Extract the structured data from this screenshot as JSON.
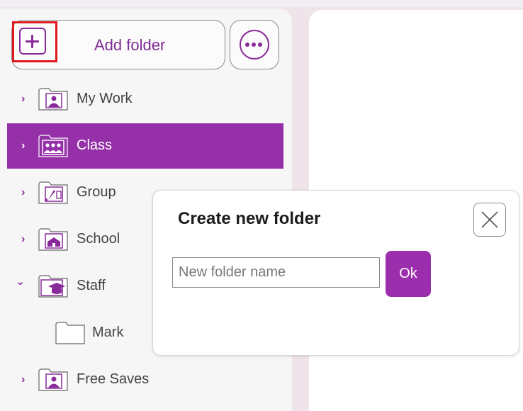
{
  "toolbar": {
    "add_folder_label": "Add folder",
    "add_icon": "plus-square-icon",
    "more_icon": "more-options-icon"
  },
  "tree": {
    "items": [
      {
        "label": "My Work",
        "icon": "person-folder-icon",
        "expanded": false,
        "selected": false
      },
      {
        "label": "Class",
        "icon": "class-folder-icon",
        "expanded": false,
        "selected": true
      },
      {
        "label": "Group",
        "icon": "music-folder-icon",
        "expanded": false,
        "selected": false
      },
      {
        "label": "School",
        "icon": "school-folder-icon",
        "expanded": false,
        "selected": false
      },
      {
        "label": "Staff",
        "icon": "staff-folder-icon",
        "expanded": true,
        "selected": false,
        "children": [
          {
            "label": "Mark",
            "icon": "empty-folder-icon"
          }
        ]
      },
      {
        "label": "Free Saves",
        "icon": "person-folder-icon",
        "expanded": false,
        "selected": false
      }
    ]
  },
  "dialog": {
    "title": "Create new folder",
    "input_value": "",
    "input_placeholder": "New folder name",
    "ok_label": "Ok",
    "close_icon": "close-icon"
  },
  "colors": {
    "accent": "#9530a8",
    "highlight": "#e0191f"
  }
}
